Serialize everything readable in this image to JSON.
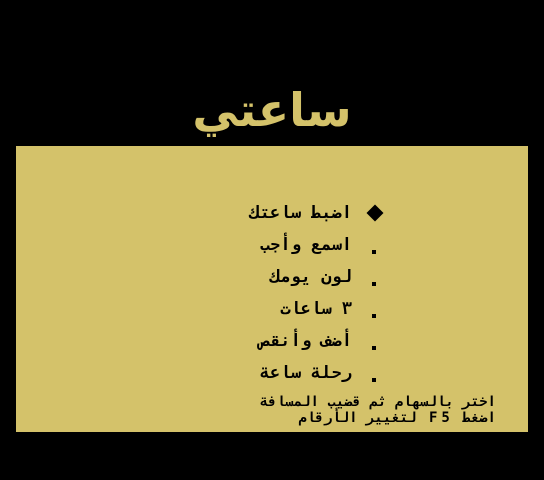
{
  "title": "ساعتي",
  "menu": {
    "items": [
      {
        "label": "اضبط ساعتك",
        "selected": true
      },
      {
        "label": "اسمع وأجب",
        "selected": false
      },
      {
        "label": "لون يومك",
        "selected": false
      },
      {
        "label": "٣ ساعات",
        "selected": false
      },
      {
        "label": "أضف وأنقص",
        "selected": false
      },
      {
        "label": "رحلة ساعة",
        "selected": false
      }
    ]
  },
  "instructions": {
    "line1": "اختر بالسهام ثم قضيب المسافة",
    "line2": "اضغط F5 لتغيير الأرقام"
  },
  "colors": {
    "background": "#000000",
    "panel": "#d4c26a",
    "text": "#000000",
    "title": "#d4c26a"
  }
}
